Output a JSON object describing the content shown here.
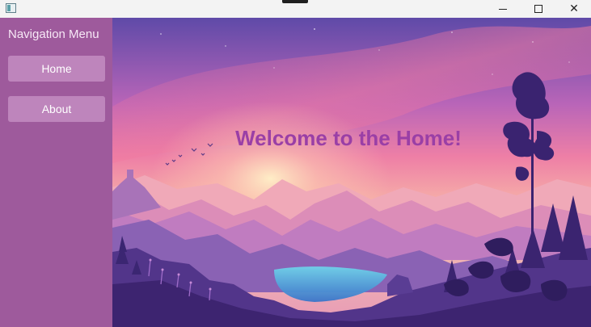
{
  "window": {
    "icons": {
      "app": "app-icon",
      "minimize": "minimize-icon",
      "maximize": "maximize-icon",
      "close": "close-icon"
    },
    "close_glyph": "✕"
  },
  "sidebar": {
    "title": "Navigation Menu",
    "items": [
      {
        "label": "Home"
      },
      {
        "label": "About"
      }
    ]
  },
  "main": {
    "heading": "Welcome to the Home!",
    "background": "landscape-illustration"
  },
  "colors": {
    "sidebar": "#9e5a9c",
    "button": "#be85bc",
    "heading": "#9a3fa6"
  }
}
